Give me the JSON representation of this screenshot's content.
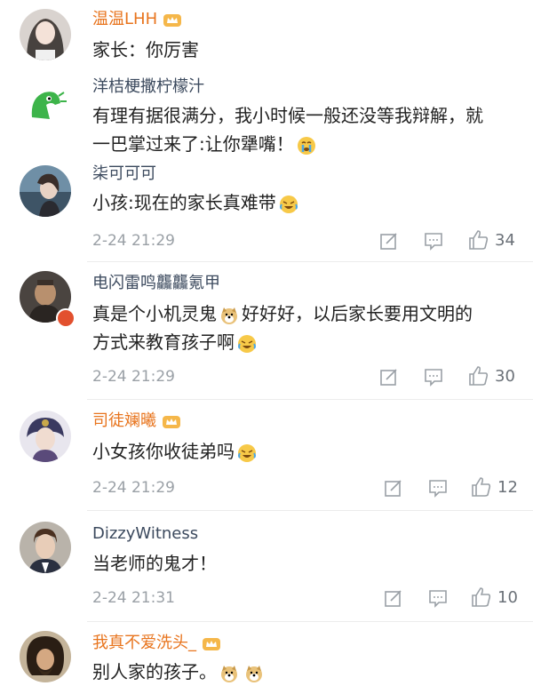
{
  "comments": [
    {
      "username": "温温LHH",
      "vip": true,
      "lines": [
        "家长：你厉害"
      ]
    },
    {
      "username": "洋桔梗撒柠檬汁",
      "vip": false,
      "lines": [
        "有理有据很满分，我小时候一般还没等我辩解，就",
        "一巴掌过来了:让你犟嘴！"
      ]
    },
    {
      "username": "柒可可可",
      "vip": false,
      "lines": [
        "小孩:现在的家长真难带"
      ],
      "time": "2-24 21:29",
      "likes": "34"
    },
    {
      "username": "电闪雷鸣龘龘氪甲",
      "vip": false,
      "lines_a": [
        "真是个小机灵鬼",
        "好好好，以后家长要用文明的"
      ],
      "lines": [
        "方式来教育孩子啊"
      ],
      "time": "2-24 21:29",
      "likes": "30"
    },
    {
      "username": "司徒斓曦",
      "vip": true,
      "lines": [
        "小女孩你收徒弟吗"
      ],
      "time": "2-24 21:29",
      "likes": "12"
    },
    {
      "username": "DizzyWitness",
      "vip": false,
      "lines": [
        "当老师的鬼才！"
      ],
      "time": "2-24 21:31",
      "likes": "10"
    },
    {
      "username": "我真不爱洗头_",
      "vip": true,
      "lines": [
        "别人家的孩子。"
      ]
    }
  ],
  "icons": {
    "repost": "repost-icon",
    "comment": "comment-icon",
    "like": "thumbs-up-icon"
  },
  "colors": {
    "username": "#3c4a5e",
    "vip_username": "#e8741d",
    "meta": "#9aa0a6"
  }
}
